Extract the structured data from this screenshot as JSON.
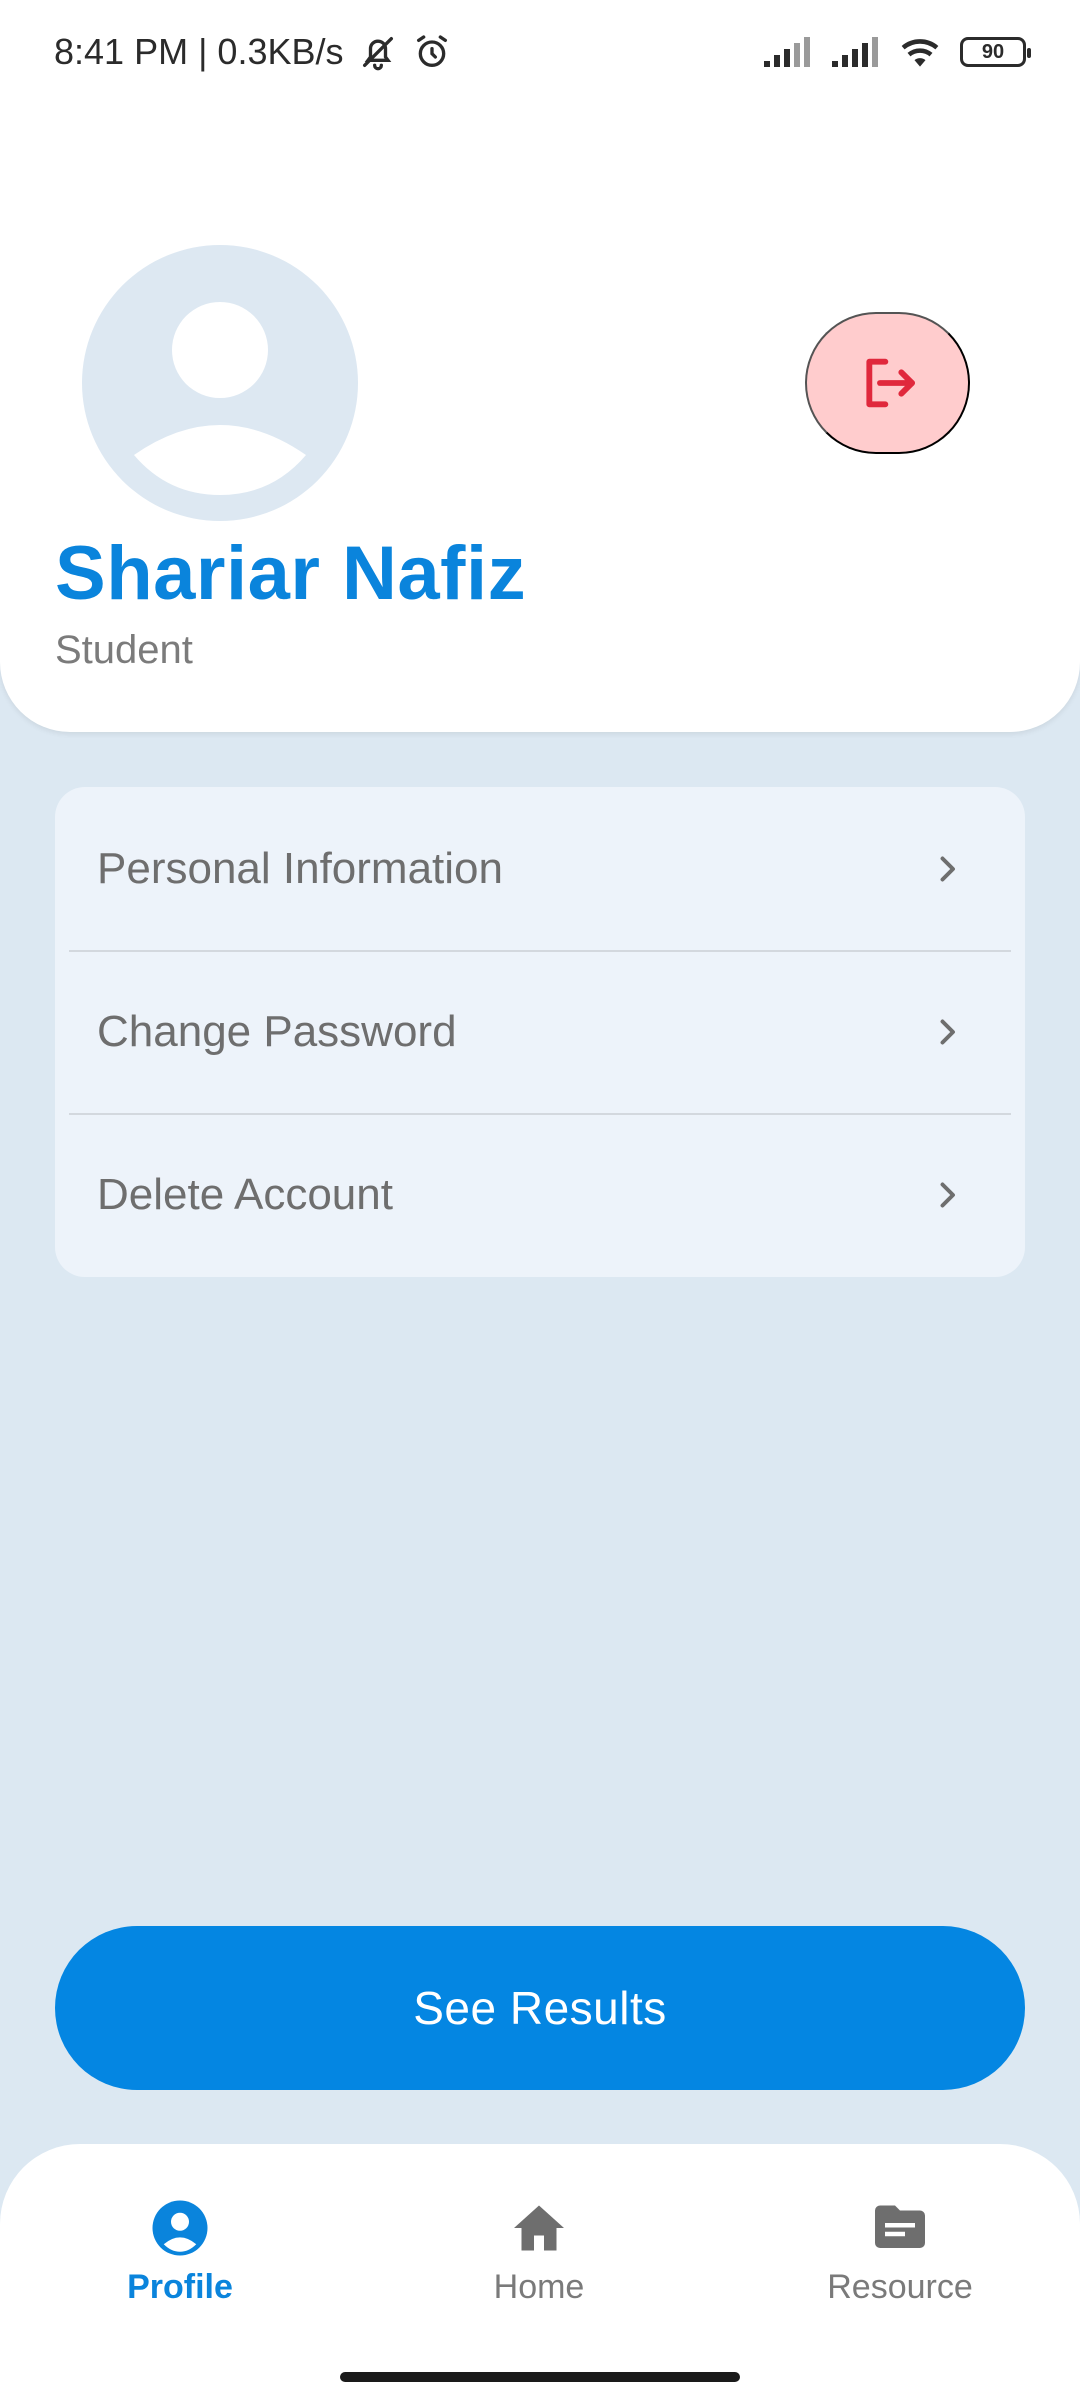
{
  "status_bar": {
    "time_speed": "8:41 PM | 0.3KB/s",
    "battery": "90",
    "icons": [
      "mute-icon",
      "alarm-icon",
      "signal-icon",
      "signal-icon",
      "wifi-icon",
      "battery-icon"
    ]
  },
  "profile": {
    "name": "Shariar Nafiz",
    "role": "Student",
    "avatar_icon": "person-placeholder-icon",
    "logout_icon": "logout-icon"
  },
  "menu": {
    "items": [
      {
        "label": "Personal Information",
        "icon": "chevron-right-icon"
      },
      {
        "label": "Change Password",
        "icon": "chevron-right-icon"
      },
      {
        "label": "Delete Account",
        "icon": "chevron-right-icon"
      }
    ]
  },
  "actions": {
    "see_results_label": "See Results"
  },
  "bottom_nav": {
    "items": [
      {
        "label": "Profile",
        "icon": "profile-icon",
        "active": true
      },
      {
        "label": "Home",
        "icon": "home-icon",
        "active": false
      },
      {
        "label": "Resource",
        "icon": "folder-icon",
        "active": false
      }
    ]
  },
  "colors": {
    "primary": "#0486e2",
    "accent_text": "#0a84dc",
    "background": "#dce8f2",
    "logout_bg": "#ffcccd",
    "logout_icon": "#e0283c"
  }
}
